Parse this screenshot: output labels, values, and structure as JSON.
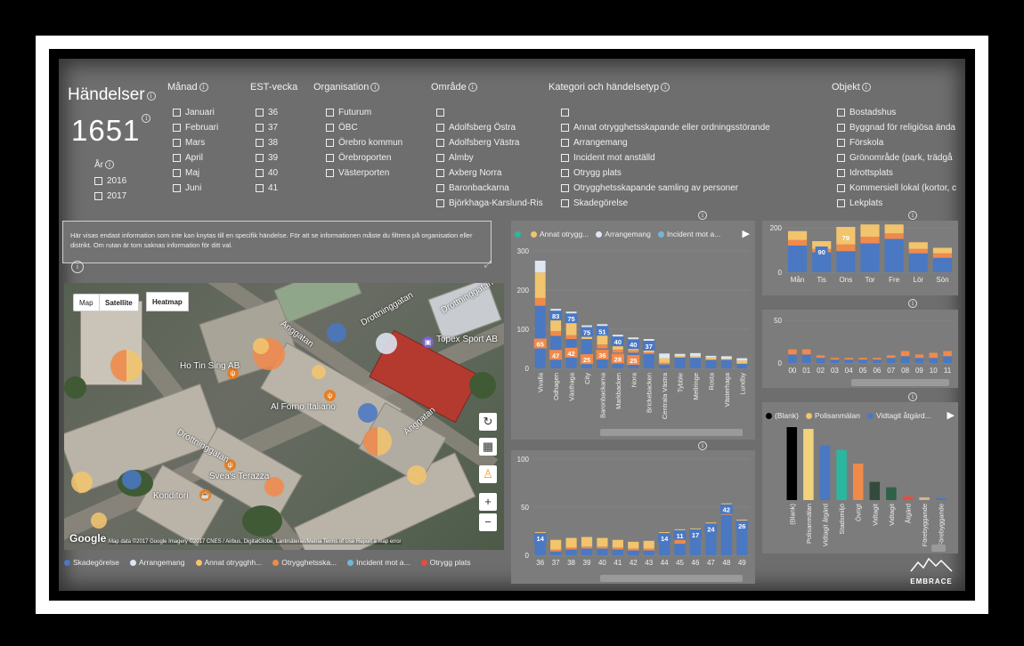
{
  "colors": {
    "skadegorelse": "#4a78c2",
    "arrangemang": "#dde6f2",
    "annat": "#f2c46d",
    "otrygghet": "#f08a4b",
    "incident": "#6fb6d9",
    "otrygg_plats": "#e84c3d",
    "teal": "#2ab7a0",
    "black": "#000000",
    "dark_green": "#2f6048"
  },
  "header": {
    "title": "Händelser",
    "count": "1651",
    "year_title": "År",
    "years": [
      "2016",
      "2017"
    ]
  },
  "slicers": {
    "manad": {
      "title": "Månad",
      "items": [
        "Januari",
        "Februari",
        "Mars",
        "April",
        "Maj",
        "Juni"
      ]
    },
    "est_vecka": {
      "title": "EST-vecka",
      "items": [
        "36",
        "37",
        "38",
        "39",
        "40",
        "41"
      ]
    },
    "organisation": {
      "title": "Organisation",
      "items": [
        "Futurum",
        "ÖBC",
        "Örebro kommun",
        "Örebroporten",
        "Västerporten"
      ]
    },
    "omrade": {
      "title": "Område",
      "items": [
        "",
        "Adolfsberg Östra",
        "Adolfsberg Västra",
        "Almby",
        "Axberg Norra",
        "Baronbackarna",
        "Björkhaga-Karslund-Ris"
      ]
    },
    "kategori": {
      "title": "Kategori och händelsetyp",
      "items": [
        "",
        "Annat otrygghetsskapande eller ordningsstörande",
        "Arrangemang",
        "Incident mot anställd",
        "Otrygg plats",
        "Otrygghetsskapande samling av personer",
        "Skadegörelse"
      ]
    },
    "objekt": {
      "title": "Objekt",
      "items": [
        "Bostadshus",
        "Byggnad för religiösa ända",
        "Förskola",
        "Grönområde (park, trädgå",
        "Idrottsplats",
        "Kommersiell lokal (kortor, c",
        "Lekplats"
      ]
    }
  },
  "notice": {
    "text": "Här visas endast information som inte kan knytas till en specifik händelse. För att se informationen måste du filtrera på organisation eller distrikt. Om rutan är tom saknas information för ditt val."
  },
  "map": {
    "btn_map": "Map",
    "btn_satellite": "Satellite",
    "btn_heatmap": "Heatmap",
    "google_logo": "Google",
    "attribution": "Map data ©2017 Google Imagery ©2017 CNES / Airbus, DigitalGlobe, Lantmäteriet/Metria    Terms of Use    Report a map error",
    "labels": {
      "drottninggatan1": "Drottninggatan",
      "anggatan1": "Änggatan",
      "drottninggatan2": "Drottninggatan",
      "anggatan2": "Änggatan",
      "restaurant1": "Ho Tin Sing AB",
      "restaurant2": "Al Forno Italiano",
      "restaurant3": "Svea's Terazza",
      "restaurant4": "Konditori",
      "shop": "Topex Sport AB"
    },
    "legend": [
      "Skadegörelse",
      "Arrangemang",
      "Annat otrygghh...",
      "Otrygghetsska...",
      "Incident mot a...",
      "Otrygg plats"
    ]
  },
  "chart_top_legend": [
    "",
    "Annat otrygg...",
    "Arrangemang",
    "Incident mot a..."
  ],
  "chart_weekday_legend_none": "",
  "chart_right_legend": [
    "(Blank)",
    "Polisanmälan",
    "Vidtagit åtgärd..."
  ],
  "brand": "EMBRACE",
  "chart_data": [
    {
      "type": "bar",
      "stacked": true,
      "categories": [
        "Vivalla",
        "Odhagen",
        "Västhaga",
        "City",
        "Baronbackarna",
        "Markbacken",
        "Nora",
        "Brickebacken",
        "Centrala Västra",
        "Tybble",
        "Mellringe",
        "Rosta",
        "Västerhaga",
        "Lundby"
      ],
      "series": [
        {
          "name": "Skadegörelse",
          "values": [
            160,
            83,
            75,
            75,
            51,
            40,
            40,
            37,
            10,
            28,
            27,
            22,
            22,
            12
          ]
        },
        {
          "name": "Otrygghetsskapande samling",
          "values": [
            20,
            12,
            10,
            0,
            10,
            8,
            6,
            4,
            4,
            0,
            0,
            0,
            0,
            0
          ]
        },
        {
          "name": "Annat otrygghetsskapande",
          "values": [
            65,
            47,
            42,
            25,
            36,
            28,
            25,
            18,
            12,
            4,
            4,
            6,
            3,
            8
          ]
        },
        {
          "name": "Arrangemang",
          "values": [
            30,
            10,
            18,
            10,
            16,
            10,
            8,
            16,
            12,
            5,
            8,
            4,
            6,
            6
          ]
        }
      ],
      "data_labels": {
        "top": [
          null,
          83,
          75,
          75,
          51,
          40,
          40,
          37
        ],
        "mid": [
          65,
          47,
          42,
          25,
          36,
          28,
          25
        ]
      },
      "ylim": [
        0,
        300
      ],
      "yticks": [
        0,
        100,
        200,
        300
      ]
    },
    {
      "type": "bar",
      "stacked": true,
      "categories": [
        "Mån",
        "Tis",
        "Ons",
        "Tor",
        "Fre",
        "Lör",
        "Sön"
      ],
      "series": [
        {
          "name": "Skadegörelse",
          "values": [
            120,
            90,
            95,
            130,
            150,
            85,
            65
          ]
        },
        {
          "name": "Otrygghetsskapande samling",
          "values": [
            25,
            15,
            30,
            30,
            25,
            20,
            20
          ]
        },
        {
          "name": "Annat otrygghetsskapande",
          "values": [
            40,
            35,
            79,
            55,
            40,
            30,
            25
          ]
        }
      ],
      "data_labels": {
        "Tis": 90,
        "Ons": 79
      },
      "ylim": [
        0,
        200
      ],
      "yticks": [
        0,
        200
      ]
    },
    {
      "type": "bar",
      "stacked": true,
      "categories": [
        "00",
        "01",
        "02",
        "03",
        "04",
        "05",
        "06",
        "07",
        "08",
        "09",
        "10",
        "11"
      ],
      "series": [
        {
          "name": "Skadegörelse",
          "values": [
            10,
            10,
            6,
            4,
            4,
            4,
            4,
            6,
            8,
            6,
            6,
            8
          ]
        },
        {
          "name": "Annat otrygghetsskapande",
          "values": [
            6,
            6,
            3,
            2,
            2,
            2,
            2,
            3,
            6,
            4,
            6,
            6
          ]
        }
      ],
      "ylim": [
        0,
        50
      ],
      "yticks": [
        0,
        50
      ]
    },
    {
      "type": "bar",
      "stacked": true,
      "categories": [
        "36",
        "37",
        "38",
        "39",
        "40",
        "41",
        "42",
        "43",
        "44",
        "45",
        "46",
        "47",
        "48",
        "49"
      ],
      "series": [
        {
          "name": "Skadegörelse",
          "values": [
            14,
            4,
            6,
            7,
            7,
            6,
            5,
            5,
            14,
            12,
            17,
            24,
            42,
            26
          ]
        },
        {
          "name": "Otrygghetsskapande samling",
          "values": [
            2,
            2,
            2,
            2,
            2,
            2,
            2,
            2,
            2,
            11,
            3,
            2,
            4,
            3
          ]
        },
        {
          "name": "Annat otrygghetsskapande",
          "values": [
            8,
            10,
            10,
            10,
            9,
            8,
            7,
            8,
            8,
            4,
            8,
            8,
            8,
            8
          ]
        }
      ],
      "data_labels": {
        "36": 14,
        "44": 14,
        "45": 11,
        "46": 17,
        "47": 24,
        "48": 42,
        "49": 26
      },
      "ylim": [
        0,
        100
      ],
      "yticks": [
        0,
        50,
        100
      ]
    },
    {
      "type": "bar",
      "categories": [
        "(Blank)",
        "Polisanmälan",
        "Vidtagit åtgärd",
        "Stadsmiljö",
        "Övrigt",
        "Vidtagit",
        "Vidtagit",
        "Åtgärd",
        "Förebyggande",
        "Förebyggande"
      ],
      "values": [
        80,
        78,
        60,
        55,
        40,
        20,
        14,
        4,
        3,
        2
      ],
      "colors": [
        "#000000",
        "#f2d27a",
        "#4a78c2",
        "#2ab7a0",
        "#f08a4b",
        "#344a3c",
        "#2f6048",
        "#e84c3d",
        "#d4b48a",
        "#4a78c2"
      ]
    }
  ]
}
